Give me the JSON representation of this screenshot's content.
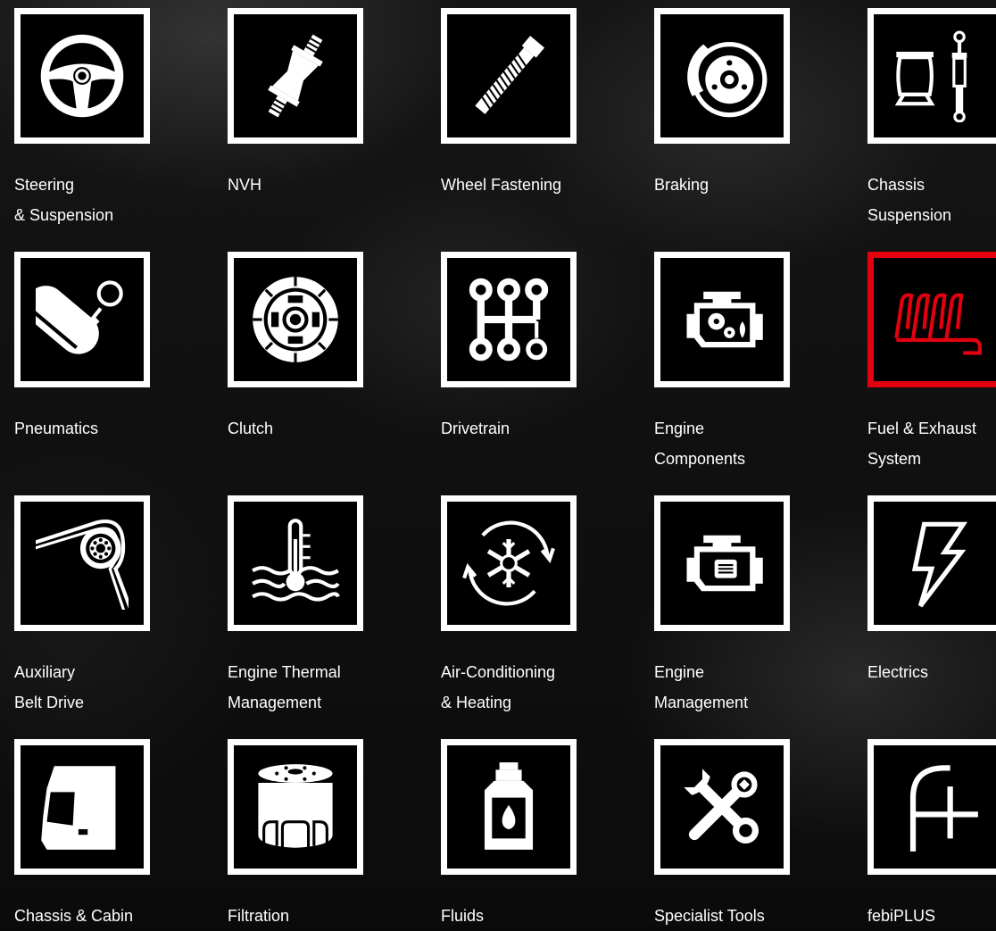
{
  "accent_color": "#e3000f",
  "categories": [
    {
      "name": "steering-suspension",
      "icon": "steering-wheel-icon",
      "line1": "Steering",
      "line2": "& Suspension"
    },
    {
      "name": "nvh",
      "icon": "nvh-mount-icon",
      "line1": "NVH",
      "line2": ""
    },
    {
      "name": "wheel-fastening",
      "icon": "wheel-bolt-icon",
      "line1": "Wheel Fastening",
      "line2": ""
    },
    {
      "name": "braking",
      "icon": "brake-disc-icon",
      "line1": "Braking",
      "line2": ""
    },
    {
      "name": "chassis-suspension",
      "icon": "air-spring-shock-icon",
      "line1": "Chassis",
      "line2": "Suspension"
    },
    {
      "name": "pneumatics",
      "icon": "pneumatic-tank-icon",
      "line1": "Pneumatics",
      "line2": ""
    },
    {
      "name": "clutch",
      "icon": "clutch-disc-icon",
      "line1": "Clutch",
      "line2": ""
    },
    {
      "name": "drivetrain",
      "icon": "gear-shift-icon",
      "line1": "Drivetrain",
      "line2": ""
    },
    {
      "name": "engine-components",
      "icon": "engine-gears-icon",
      "line1": "Engine",
      "line2": "Components"
    },
    {
      "name": "fuel-exhaust",
      "icon": "exhaust-manifold-icon",
      "line1": "Fuel & Exhaust",
      "line2": "System"
    },
    {
      "name": "auxiliary-belt-drive",
      "icon": "belt-pulley-icon",
      "line1": "Auxiliary",
      "line2": "Belt Drive"
    },
    {
      "name": "engine-thermal-management",
      "icon": "coolant-thermometer-icon",
      "line1": "Engine Thermal",
      "line2": "Management"
    },
    {
      "name": "air-conditioning-heating",
      "icon": "ac-heating-icon",
      "line1": "Air-Conditioning",
      "line2": "& Heating"
    },
    {
      "name": "engine-management",
      "icon": "engine-management-icon",
      "line1": "Engine",
      "line2": "Management"
    },
    {
      "name": "electrics",
      "icon": "lightning-bolt-icon",
      "line1": "Electrics",
      "line2": ""
    },
    {
      "name": "chassis-cabin",
      "icon": "truck-cabin-icon",
      "line1": "Chassis & Cabin",
      "line2": ""
    },
    {
      "name": "filtration",
      "icon": "oil-filter-icon",
      "line1": "Filtration",
      "line2": ""
    },
    {
      "name": "fluids",
      "icon": "fluid-bottle-icon",
      "line1": "Fluids",
      "line2": ""
    },
    {
      "name": "specialist-tools",
      "icon": "tools-icon",
      "line1": "Specialist Tools",
      "line2": ""
    },
    {
      "name": "febiplus",
      "icon": "febiplus-logo-icon",
      "line1": "febiPLUS",
      "line2": ""
    }
  ]
}
